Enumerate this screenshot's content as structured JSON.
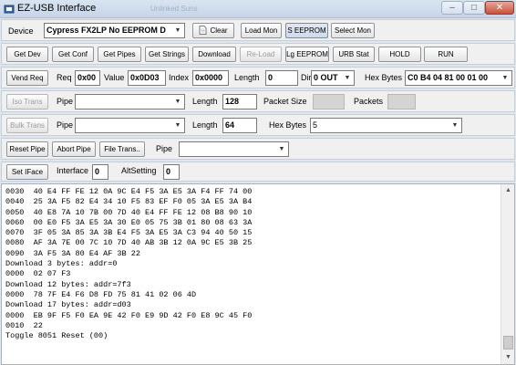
{
  "window": {
    "title": "EZ-USB Interface",
    "ghost_title": "Unlinked Suns",
    "min": "–",
    "max": "□",
    "close": "✕"
  },
  "row1": {
    "device_label": "Device",
    "device_value": "Cypress FX2LP No EEPROM D",
    "clear": "Clear",
    "load_mon": "Load Mon",
    "s_eeprom": "S EEPROM",
    "select_mon": "Select Mon"
  },
  "row2": {
    "get_dev": "Get Dev",
    "get_conf": "Get Conf",
    "get_pipes": "Get Pipes",
    "get_strings": "Get Strings",
    "download": "Download",
    "reload": "Re-Load",
    "lg_eeprom": "Lg EEPROM",
    "urb_stat": "URB Stat",
    "hold": "HOLD",
    "run": "RUN"
  },
  "row3": {
    "vend_req": "Vend Req",
    "req_label": "Req",
    "req_value": "0x00",
    "value_label": "Value",
    "value_value": "0x0D03",
    "index_label": "Index",
    "index_value": "0x0000",
    "length_label": "Length",
    "length_value": "0",
    "dir_label": "Dir",
    "dir_value": "0 OUT",
    "hexbytes_label": "Hex Bytes",
    "hexbytes_value": "C0 B4 04 81 00 01 00"
  },
  "row4": {
    "iso_trans": "Iso Trans",
    "pipe_label": "Pipe",
    "pipe_value": "",
    "length_label": "Length",
    "length_value": "128",
    "packet_size_label": "Packet Size",
    "packets_label": "Packets"
  },
  "row5": {
    "bulk_trans": "Bulk Trans",
    "pipe_label": "Pipe",
    "pipe_value": "",
    "length_label": "Length",
    "length_value": "64",
    "hexbytes_label": "Hex Bytes",
    "hexbytes_value": "5"
  },
  "row6": {
    "reset_pipe": "Reset Pipe",
    "abort_pipe": "Abort Pipe",
    "file_trans": "File Trans..",
    "pipe_label": "Pipe",
    "pipe_value": ""
  },
  "row7": {
    "set_iface": "Set IFace",
    "interface_label": "Interface",
    "interface_value": "0",
    "altsetting_label": "AltSetting",
    "altsetting_value": "0"
  },
  "log": {
    "lines": [
      "0030  40 E4 FF FE 12 0A 9C E4 F5 3A E5 3A F4 FF 74 00",
      "0040  25 3A F5 82 E4 34 10 F5 83 EF F0 05 3A E5 3A B4",
      "0050  40 E8 7A 10 7B 00 7D 40 E4 FF FE 12 08 B8 90 10",
      "0060  00 E0 F5 3A E5 3A 30 E0 05 75 3B 01 80 08 63 3A",
      "0070  3F 05 3A 85 3A 3B E4 F5 3A E5 3A C3 94 40 50 15",
      "0080  AF 3A 7E 00 7C 10 7D 40 AB 3B 12 0A 9C E5 3B 25",
      "0090  3A F5 3A 80 E4 AF 3B 22",
      "Download 3 bytes: addr=0",
      "0000  02 07 F3",
      "Download 12 bytes: addr=7f3",
      "0000  78 7F E4 F6 D8 FD 75 81 41 02 06 4D",
      "Download 17 bytes: addr=d03",
      "0000  EB 9F F5 F0 EA 9E 42 F0 E9 9D 42 F0 E8 9C 45 F0",
      "0010  22",
      "Toggle 8051 Reset (00)"
    ]
  },
  "icons": {
    "app": "usb-app-icon",
    "clear": "page-icon",
    "dropdown": "chevron-down-icon"
  }
}
